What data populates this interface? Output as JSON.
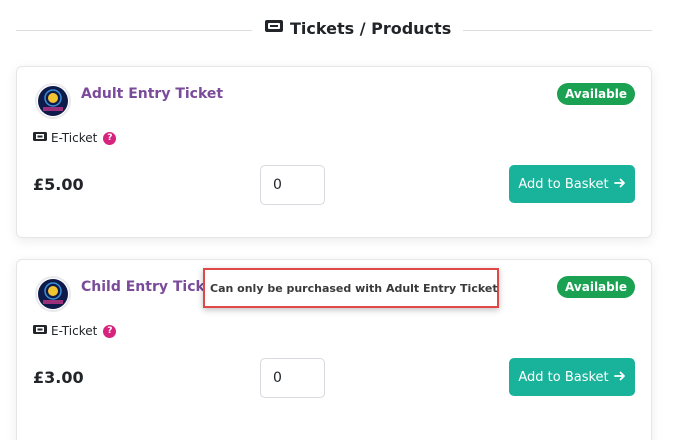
{
  "section": {
    "title": "Tickets / Products",
    "icon": "ticket-icon"
  },
  "products": [
    {
      "name": "Adult Entry Ticket",
      "badge": "Available",
      "delivery": "E-Ticket",
      "help_symbol": "?",
      "price": "£5.00",
      "quantity": "0",
      "button_label": "Add to Basket",
      "button_icon": "arrow-right-icon"
    },
    {
      "name": "Child Entry Ticket",
      "badge": "Available",
      "restriction": "Can only be purchased with Adult Entry Ticket",
      "delivery": "E-Ticket",
      "help_symbol": "?",
      "price": "£3.00",
      "quantity": "0",
      "button_label": "Add to Basket",
      "button_icon": "arrow-right-icon"
    }
  ],
  "colors": {
    "accent_purple": "#7a4b9b",
    "available_green": "#1aa152",
    "button_teal": "#18b39a",
    "help_pink": "#d6237d",
    "highlight_red": "#e04848"
  }
}
